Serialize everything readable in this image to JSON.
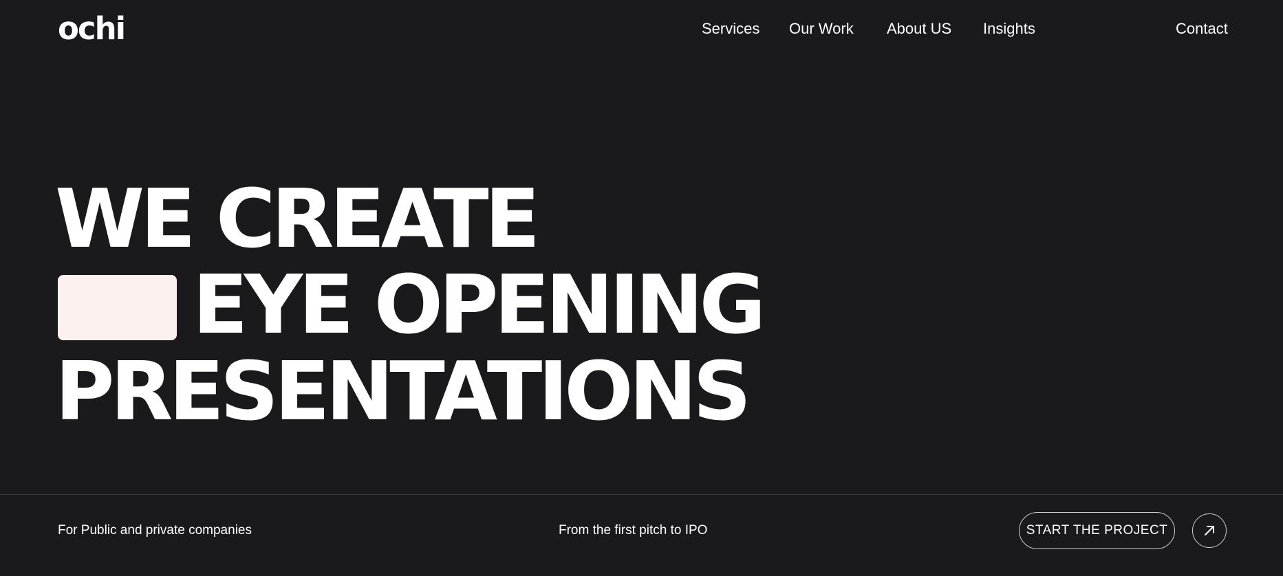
{
  "brand": {
    "logo": "ochi"
  },
  "nav": {
    "services": "Services",
    "our_work": "Our Work",
    "about": "About US",
    "insights": "Insights",
    "contact": "Contact"
  },
  "hero": {
    "line1": "WE CREATE",
    "line2": "EYE OPENING",
    "line3": "PRESENTATIONS"
  },
  "footer": {
    "left_text": "For Public and private companies",
    "mid_text": "From the first pitch to IPO",
    "cta_label": "START THE PROJECT",
    "cta_icon": "arrow-up-right-icon"
  },
  "colors": {
    "background": "#1a1a1c",
    "text": "#ffffff",
    "accent_box": "#fdf1f0"
  }
}
